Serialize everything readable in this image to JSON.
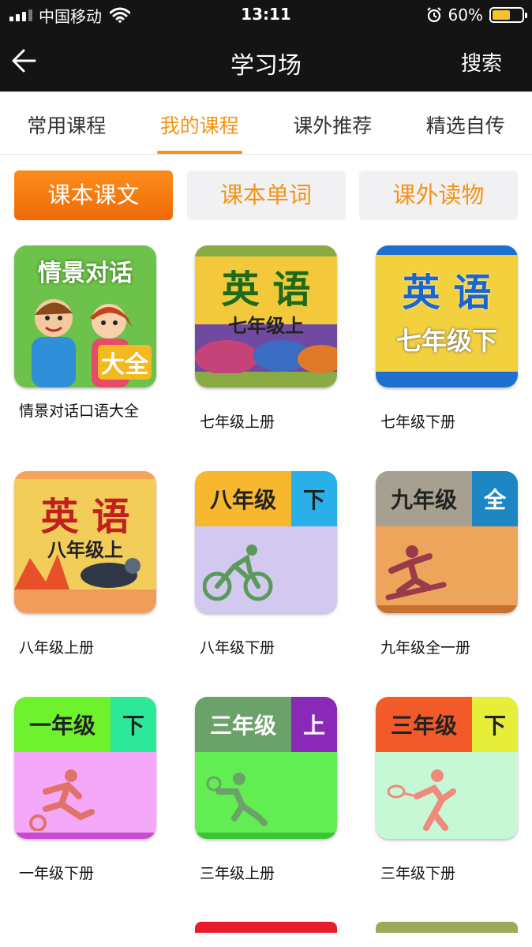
{
  "status_bar": {
    "carrier": "中国移动",
    "time": "13:11",
    "battery_percent": "60%",
    "battery_level": 0.6
  },
  "nav": {
    "title": "学习场",
    "search_label": "搜索"
  },
  "tabs": [
    {
      "label": "常用课程",
      "active": false
    },
    {
      "label": "我的课程",
      "active": true
    },
    {
      "label": "课外推荐",
      "active": false
    },
    {
      "label": "精选自传",
      "active": false
    }
  ],
  "segments": [
    {
      "label": "课本课文",
      "active": true
    },
    {
      "label": "课本单词",
      "active": false
    },
    {
      "label": "课外读物",
      "active": false
    }
  ],
  "courses": [
    {
      "caption": "情景对话口语大全",
      "cover_title": "情景对话",
      "cover_badge": "大全"
    },
    {
      "caption": "七年级上册",
      "cover_title": "英 语",
      "cover_sub": "七年级上"
    },
    {
      "caption": "七年级下册",
      "cover_title": "英 语",
      "cover_sub": "七年级下"
    },
    {
      "caption": "八年级上册",
      "cover_title": "英 语",
      "cover_sub": "八年级上"
    },
    {
      "caption": "八年级下册",
      "cover_title": "八年级",
      "cover_tag": "下"
    },
    {
      "caption": "九年级全一册",
      "cover_title": "九年级",
      "cover_tag": "全"
    },
    {
      "caption": "一年级下册",
      "cover_title": "一年级",
      "cover_tag": "下"
    },
    {
      "caption": "三年级上册",
      "cover_title": "三年级",
      "cover_tag": "上"
    },
    {
      "caption": "三年级下册",
      "cover_title": "三年级",
      "cover_tag": "下"
    }
  ],
  "colors": {
    "accent": "#f39416",
    "header_bg": "#141414"
  }
}
